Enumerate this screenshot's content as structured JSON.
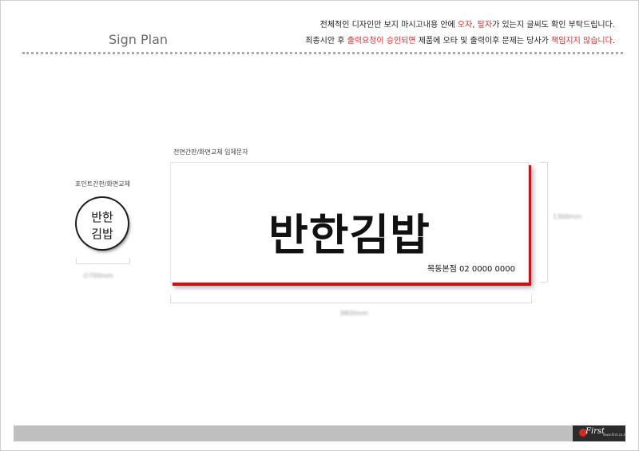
{
  "header": {
    "title": "Sign Plan",
    "notice_line1_parts": [
      "전체적인 디자인만 보지 마시고내용 안에 ",
      "오자",
      ", ",
      "탈자",
      "가 있는지 글씨도 확인 부탁드립니다."
    ],
    "notice_line2_parts": [
      "최종시안 후 ",
      "출력요청이 승인되면",
      " 제품에 오타 및 출력이후 문제는 당사가 ",
      "책임지지 않습니다",
      "."
    ]
  },
  "point_sign": {
    "label": "포인트간판/화면교체",
    "text_line1": "반한",
    "text_line2": "김밥",
    "size_text": "∅700mm"
  },
  "main_sign": {
    "label": "전면간판/화면교체 입체문자",
    "name": "반한김밥",
    "subtext": "목동본점 02 0000 0000",
    "width_text": "3800mm",
    "height_text": "1300mm"
  },
  "footer": {
    "logo_text": "First",
    "logo_sub": "www.first.co.kr"
  },
  "colors": {
    "accent_red": "#e0282c",
    "sign_shadow_red": "#c9121b",
    "footer_gray": "#bfbfbf"
  }
}
